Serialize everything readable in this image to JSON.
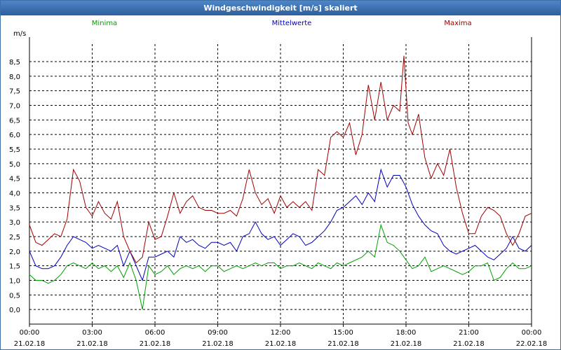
{
  "window": {
    "title": "Windgeschwindigkeit [m/s] skaliert"
  },
  "chart_data": {
    "type": "line",
    "title": "Windgeschwindigkeit [m/s] skaliert",
    "ylabel": "m/s",
    "xlabel": "",
    "ylim": [
      -0.5,
      9.1
    ],
    "xlim": [
      0,
      24
    ],
    "grid": true,
    "legend_position": "top",
    "y_ticks": [
      "0,0",
      "0,5",
      "1,0",
      "1,5",
      "2,0",
      "2,5",
      "3,0",
      "3,5",
      "4,0",
      "4,5",
      "5,0",
      "5,5",
      "6,0",
      "6,5",
      "7,0",
      "7,5",
      "8,0",
      "8,5"
    ],
    "x_ticks": [
      {
        "time": "00:00",
        "date": "21.02.18"
      },
      {
        "time": "03:00",
        "date": "21.02.18"
      },
      {
        "time": "06:00",
        "date": "21.02.18"
      },
      {
        "time": "09:00",
        "date": "21.02.18"
      },
      {
        "time": "12:00",
        "date": "21.02.18"
      },
      {
        "time": "15:00",
        "date": "21.02.18"
      },
      {
        "time": "18:00",
        "date": "21.02.18"
      },
      {
        "time": "21:00",
        "date": "21.02.18"
      },
      {
        "time": "00:00",
        "date": "22.02.18"
      }
    ],
    "x_unit": "hours since 21.02.18 00:00",
    "series": [
      {
        "name": "Minima",
        "color": "#00a000",
        "points": [
          [
            0,
            1.2
          ],
          [
            0.3,
            1.0
          ],
          [
            0.6,
            1.0
          ],
          [
            0.9,
            0.9
          ],
          [
            1.2,
            1.0
          ],
          [
            1.5,
            1.2
          ],
          [
            1.8,
            1.5
          ],
          [
            2.1,
            1.6
          ],
          [
            2.4,
            1.5
          ],
          [
            2.7,
            1.4
          ],
          [
            3.0,
            1.6
          ],
          [
            3.3,
            1.4
          ],
          [
            3.6,
            1.5
          ],
          [
            3.9,
            1.3
          ],
          [
            4.2,
            1.5
          ],
          [
            4.5,
            1.1
          ],
          [
            4.8,
            1.6
          ],
          [
            5.1,
            1.0
          ],
          [
            5.4,
            0.0
          ],
          [
            5.7,
            1.5
          ],
          [
            6.0,
            1.2
          ],
          [
            6.3,
            1.3
          ],
          [
            6.6,
            1.5
          ],
          [
            6.9,
            1.2
          ],
          [
            7.2,
            1.4
          ],
          [
            7.5,
            1.5
          ],
          [
            7.8,
            1.4
          ],
          [
            8.1,
            1.5
          ],
          [
            8.4,
            1.3
          ],
          [
            8.7,
            1.5
          ],
          [
            9.0,
            1.5
          ],
          [
            9.3,
            1.3
          ],
          [
            9.6,
            1.4
          ],
          [
            9.9,
            1.5
          ],
          [
            10.2,
            1.4
          ],
          [
            10.5,
            1.5
          ],
          [
            10.8,
            1.6
          ],
          [
            11.1,
            1.5
          ],
          [
            11.4,
            1.6
          ],
          [
            11.7,
            1.6
          ],
          [
            12.0,
            1.4
          ],
          [
            12.3,
            1.5
          ],
          [
            12.6,
            1.5
          ],
          [
            12.9,
            1.6
          ],
          [
            13.2,
            1.5
          ],
          [
            13.5,
            1.4
          ],
          [
            13.8,
            1.6
          ],
          [
            14.1,
            1.5
          ],
          [
            14.4,
            1.4
          ],
          [
            14.7,
            1.6
          ],
          [
            15.0,
            1.5
          ],
          [
            15.3,
            1.6
          ],
          [
            15.6,
            1.7
          ],
          [
            15.9,
            1.8
          ],
          [
            16.2,
            2.0
          ],
          [
            16.5,
            1.8
          ],
          [
            16.8,
            2.9
          ],
          [
            17.1,
            2.3
          ],
          [
            17.4,
            2.2
          ],
          [
            17.7,
            2.0
          ],
          [
            18.0,
            1.7
          ],
          [
            18.3,
            1.4
          ],
          [
            18.6,
            1.5
          ],
          [
            18.9,
            1.8
          ],
          [
            19.2,
            1.3
          ],
          [
            19.5,
            1.4
          ],
          [
            19.8,
            1.5
          ],
          [
            20.1,
            1.4
          ],
          [
            20.4,
            1.3
          ],
          [
            20.7,
            1.2
          ],
          [
            21.0,
            1.3
          ],
          [
            21.3,
            1.5
          ],
          [
            21.6,
            1.5
          ],
          [
            21.9,
            1.6
          ],
          [
            22.2,
            1.0
          ],
          [
            22.5,
            1.1
          ],
          [
            22.8,
            1.4
          ],
          [
            23.1,
            1.6
          ],
          [
            23.4,
            1.4
          ],
          [
            23.7,
            1.4
          ],
          [
            24.0,
            1.5
          ]
        ]
      },
      {
        "name": "Mittelwerte",
        "color": "#0000c0",
        "points": [
          [
            0,
            2.0
          ],
          [
            0.3,
            1.5
          ],
          [
            0.6,
            1.4
          ],
          [
            0.9,
            1.4
          ],
          [
            1.2,
            1.5
          ],
          [
            1.5,
            1.8
          ],
          [
            1.8,
            2.2
          ],
          [
            2.1,
            2.5
          ],
          [
            2.4,
            2.4
          ],
          [
            2.7,
            2.3
          ],
          [
            3.0,
            2.1
          ],
          [
            3.3,
            2.2
          ],
          [
            3.6,
            2.1
          ],
          [
            3.9,
            2.0
          ],
          [
            4.2,
            2.2
          ],
          [
            4.5,
            1.5
          ],
          [
            4.8,
            2.0
          ],
          [
            5.1,
            1.5
          ],
          [
            5.4,
            1.0
          ],
          [
            5.7,
            1.8
          ],
          [
            6.0,
            1.8
          ],
          [
            6.3,
            1.9
          ],
          [
            6.6,
            2.0
          ],
          [
            6.9,
            1.8
          ],
          [
            7.2,
            2.5
          ],
          [
            7.5,
            2.3
          ],
          [
            7.8,
            2.4
          ],
          [
            8.1,
            2.2
          ],
          [
            8.4,
            2.1
          ],
          [
            8.7,
            2.3
          ],
          [
            9.0,
            2.3
          ],
          [
            9.3,
            2.2
          ],
          [
            9.6,
            2.3
          ],
          [
            9.9,
            2.0
          ],
          [
            10.2,
            2.5
          ],
          [
            10.5,
            2.6
          ],
          [
            10.8,
            3.0
          ],
          [
            11.1,
            2.6
          ],
          [
            11.4,
            2.4
          ],
          [
            11.7,
            2.5
          ],
          [
            12.0,
            2.2
          ],
          [
            12.3,
            2.4
          ],
          [
            12.6,
            2.6
          ],
          [
            12.9,
            2.5
          ],
          [
            13.2,
            2.2
          ],
          [
            13.5,
            2.3
          ],
          [
            13.8,
            2.5
          ],
          [
            14.1,
            2.7
          ],
          [
            14.4,
            3.0
          ],
          [
            14.7,
            3.4
          ],
          [
            15.0,
            3.5
          ],
          [
            15.3,
            3.7
          ],
          [
            15.6,
            3.9
          ],
          [
            15.9,
            3.6
          ],
          [
            16.2,
            4.0
          ],
          [
            16.5,
            3.7
          ],
          [
            16.8,
            4.8
          ],
          [
            17.1,
            4.2
          ],
          [
            17.4,
            4.6
          ],
          [
            17.7,
            4.6
          ],
          [
            18.0,
            4.2
          ],
          [
            18.3,
            3.6
          ],
          [
            18.6,
            3.2
          ],
          [
            18.9,
            2.9
          ],
          [
            19.2,
            2.7
          ],
          [
            19.5,
            2.6
          ],
          [
            19.8,
            2.2
          ],
          [
            20.1,
            2.0
          ],
          [
            20.4,
            1.9
          ],
          [
            20.7,
            2.0
          ],
          [
            21.0,
            2.1
          ],
          [
            21.3,
            2.2
          ],
          [
            21.6,
            2.0
          ],
          [
            21.9,
            1.8
          ],
          [
            22.2,
            1.7
          ],
          [
            22.5,
            1.9
          ],
          [
            22.8,
            2.1
          ],
          [
            23.1,
            2.5
          ],
          [
            23.4,
            2.1
          ],
          [
            23.7,
            2.0
          ],
          [
            24.0,
            2.2
          ]
        ]
      },
      {
        "name": "Maxima",
        "color": "#a00000",
        "points": [
          [
            0,
            2.9
          ],
          [
            0.3,
            2.3
          ],
          [
            0.6,
            2.2
          ],
          [
            0.9,
            2.4
          ],
          [
            1.2,
            2.6
          ],
          [
            1.5,
            2.5
          ],
          [
            1.8,
            3.1
          ],
          [
            2.1,
            4.8
          ],
          [
            2.4,
            4.4
          ],
          [
            2.7,
            3.5
          ],
          [
            3.0,
            3.2
          ],
          [
            3.3,
            3.7
          ],
          [
            3.6,
            3.3
          ],
          [
            3.9,
            3.1
          ],
          [
            4.2,
            3.7
          ],
          [
            4.5,
            2.5
          ],
          [
            4.8,
            2.0
          ],
          [
            5.1,
            1.6
          ],
          [
            5.4,
            1.8
          ],
          [
            5.7,
            3.0
          ],
          [
            6.0,
            2.4
          ],
          [
            6.3,
            2.5
          ],
          [
            6.6,
            3.2
          ],
          [
            6.9,
            4.0
          ],
          [
            7.2,
            3.3
          ],
          [
            7.5,
            3.7
          ],
          [
            7.8,
            3.9
          ],
          [
            8.1,
            3.5
          ],
          [
            8.4,
            3.4
          ],
          [
            8.7,
            3.4
          ],
          [
            9.0,
            3.3
          ],
          [
            9.3,
            3.3
          ],
          [
            9.6,
            3.4
          ],
          [
            9.9,
            3.2
          ],
          [
            10.2,
            3.8
          ],
          [
            10.5,
            4.8
          ],
          [
            10.8,
            4.0
          ],
          [
            11.1,
            3.6
          ],
          [
            11.4,
            3.8
          ],
          [
            11.7,
            3.3
          ],
          [
            12.0,
            3.9
          ],
          [
            12.3,
            3.5
          ],
          [
            12.6,
            3.7
          ],
          [
            12.9,
            3.5
          ],
          [
            13.2,
            3.7
          ],
          [
            13.5,
            3.4
          ],
          [
            13.8,
            4.8
          ],
          [
            14.1,
            4.6
          ],
          [
            14.4,
            5.9
          ],
          [
            14.7,
            6.1
          ],
          [
            15.0,
            5.9
          ],
          [
            15.3,
            6.4
          ],
          [
            15.6,
            5.3
          ],
          [
            15.9,
            6.0
          ],
          [
            16.2,
            7.7
          ],
          [
            16.5,
            6.5
          ],
          [
            16.8,
            7.8
          ],
          [
            17.1,
            6.5
          ],
          [
            17.4,
            7.0
          ],
          [
            17.7,
            6.8
          ],
          [
            17.9,
            8.7
          ],
          [
            18.1,
            6.4
          ],
          [
            18.3,
            6.0
          ],
          [
            18.6,
            6.7
          ],
          [
            18.9,
            5.2
          ],
          [
            19.2,
            4.5
          ],
          [
            19.5,
            5.0
          ],
          [
            19.8,
            4.6
          ],
          [
            20.1,
            5.5
          ],
          [
            20.4,
            4.2
          ],
          [
            20.7,
            3.3
          ],
          [
            21.0,
            2.6
          ],
          [
            21.3,
            2.6
          ],
          [
            21.6,
            3.2
          ],
          [
            21.9,
            3.5
          ],
          [
            22.2,
            3.4
          ],
          [
            22.5,
            3.2
          ],
          [
            22.8,
            2.6
          ],
          [
            23.1,
            2.2
          ],
          [
            23.4,
            2.6
          ],
          [
            23.7,
            3.2
          ],
          [
            24.0,
            3.3
          ]
        ]
      }
    ]
  }
}
